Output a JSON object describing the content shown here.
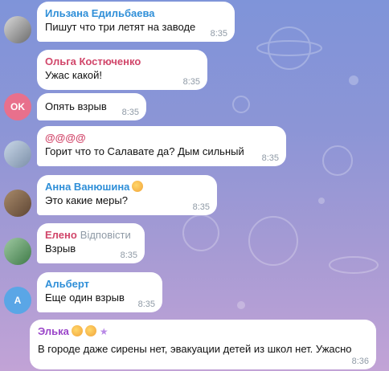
{
  "colors": {
    "name_blue": "#2f8fd8",
    "name_red": "#d1466a",
    "name_purple": "#9a45c9",
    "name_blue2": "#3a8fe0"
  },
  "messages": [
    {
      "sender": "Ильзана Едильбаева",
      "text": "Пишут что три летят на заводе",
      "time": "8:35",
      "avatar": "photo"
    },
    {
      "sender": "Ольга Костюченко",
      "text": "Ужас какой!",
      "time": "8:35"
    },
    {
      "text": "Опять взрыв",
      "time": "8:35",
      "avatar_initials": "OK"
    },
    {
      "sender": "@@@@",
      "text": "Горит что то  Салавате да? Дым сильный",
      "time": "8:35",
      "avatar": "photo"
    },
    {
      "sender": "Анна Ванюшина",
      "text": "Это какие меры?",
      "time": "8:35",
      "avatar": "photo",
      "sender_icon": "face-emoji-icon"
    },
    {
      "sender": "Елено",
      "reply_label": "Відповісти",
      "text": "Взрыв",
      "time": "8:35",
      "avatar": "photo"
    },
    {
      "sender": "Альберт",
      "text": "Еще один взрыв",
      "time": "8:35",
      "avatar_initials": "A"
    },
    {
      "sender": "Элька",
      "text": "В городе даже сирены нет, эвакуации детей из школ нет. Ужасно",
      "time": "8:36",
      "sender_icons": [
        "face-emoji-icon",
        "face-emoji-icon",
        "star-icon"
      ]
    }
  ]
}
